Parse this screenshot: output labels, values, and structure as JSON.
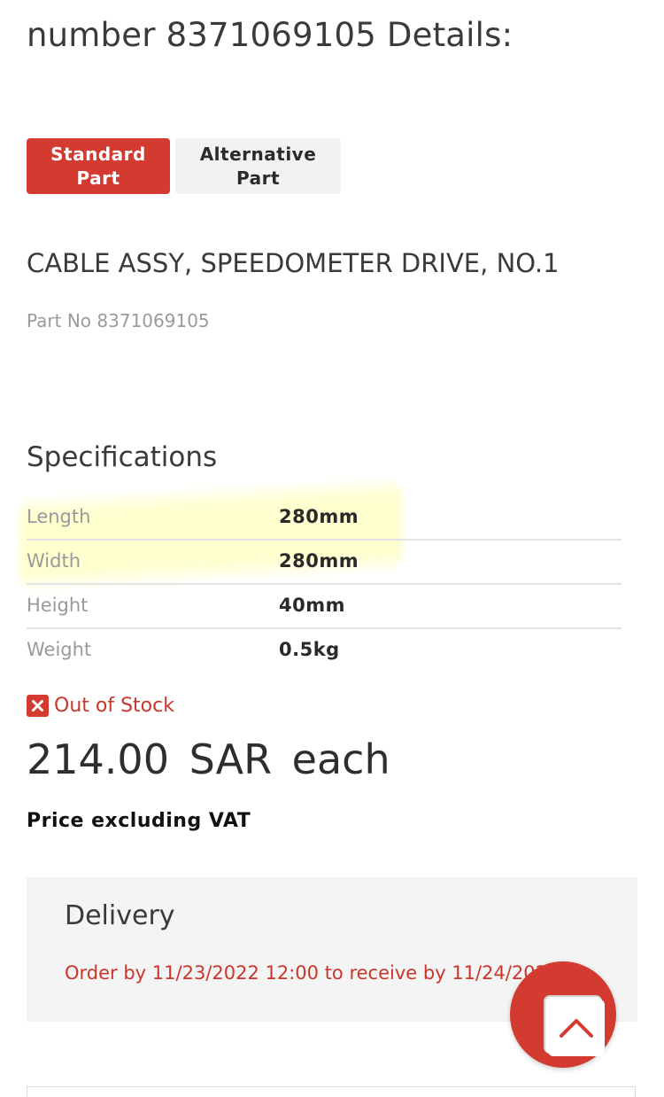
{
  "header": {
    "title": "number 8371069105 Details:"
  },
  "tabs": [
    {
      "label": "Standard Part",
      "active": true
    },
    {
      "label": "Alternative Part",
      "active": false
    }
  ],
  "part": {
    "name": "CABLE ASSY, SPEEDOMETER DRIVE, NO.1",
    "number_label": "Part No 8371069105"
  },
  "specifications": {
    "title": "Specifications",
    "rows": [
      {
        "label": "Length",
        "value": "280mm"
      },
      {
        "label": "Width",
        "value": "280mm"
      },
      {
        "label": "Height",
        "value": "40mm"
      },
      {
        "label": "Weight",
        "value": "0.5kg"
      }
    ]
  },
  "stock": {
    "status": "Out of Stock",
    "icon": "x-square-icon"
  },
  "price": {
    "text": "214.00  SAR  each",
    "vat_note": "Price excluding VAT"
  },
  "delivery": {
    "title": "Delivery",
    "text": "Order by 11/23/2022 12:00 to receive by 11/24/2022"
  },
  "fab": {
    "icon": "chevron-up-icon"
  },
  "colors": {
    "accent": "#d33a30",
    "text": "#3a3a3a",
    "muted": "#9a9a9a",
    "panel": "#f4f4f4"
  }
}
